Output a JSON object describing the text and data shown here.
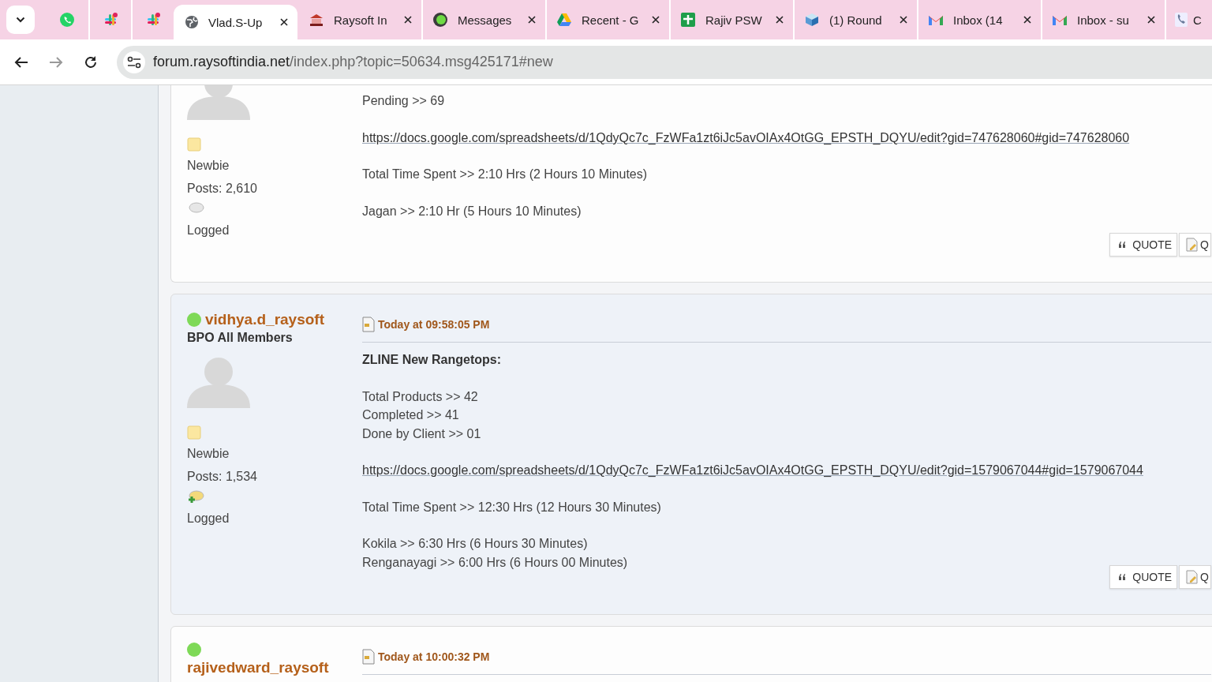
{
  "tabs": [
    {
      "kind": "whatsapp",
      "selected": false
    },
    {
      "kind": "slack",
      "selected": false
    },
    {
      "kind": "slack",
      "selected": false
    },
    {
      "kind": "globe",
      "selected": true,
      "title": "Vlad.S-Up"
    },
    {
      "kind": "raysoft",
      "selected": false,
      "title": "Raysoft In"
    },
    {
      "kind": "upwork",
      "selected": false,
      "title": "Messages"
    },
    {
      "kind": "drive",
      "selected": false,
      "title": "Recent - G"
    },
    {
      "kind": "sheets",
      "selected": false,
      "title": "Rajiv PSW"
    },
    {
      "kind": "cube",
      "selected": false,
      "title": "(1) Round"
    },
    {
      "kind": "gmail",
      "selected": false,
      "title": "Inbox (14"
    },
    {
      "kind": "gmail",
      "selected": false,
      "title": "Inbox - su"
    },
    {
      "kind": "phone",
      "selected": false,
      "title": "C"
    }
  ],
  "address_bar": {
    "host": "forum.raysoftindia.net",
    "path": "/index.php?topic=50634.msg425171#new"
  },
  "posts": [
    {
      "poster": {
        "rank": "Newbie",
        "posts": "Posts: 2,610",
        "contact_active": false,
        "logged": "Logged"
      },
      "body": [
        {
          "kind": "text",
          "lines": [
            "Pending >> 69"
          ]
        },
        {
          "kind": "link",
          "lines": [
            "https://docs.google.com/spreadsheets/d/1QdyQc7c_FzWFa1zt6iJc5avOIAx4OtGG_EPSTH_DQYU/edit?gid=747628060#gid=747628060"
          ]
        },
        {
          "kind": "text",
          "lines": [
            "Total Time Spent >> 2:10 Hrs (2 Hours 10 Minutes)"
          ]
        },
        {
          "kind": "text",
          "lines": [
            "Jagan >>  2:10 Hr (5 Hours 10 Minutes)"
          ]
        }
      ],
      "buttons": [
        "QUOTE",
        "Q"
      ],
      "shaded": false
    },
    {
      "poster": {
        "online": true,
        "name": "vidhya.d_raysoft",
        "group": "BPO All Members",
        "rank": "Newbie",
        "posts": "Posts: 1,534",
        "contact_active": true,
        "logged": "Logged"
      },
      "date": "Today at 09:58:05 PM",
      "body": [
        {
          "kind": "bold",
          "lines": [
            "ZLINE New Rangetops:"
          ]
        },
        {
          "kind": "text",
          "lines": [
            "Total Products >> 42",
            "Completed >> 41",
            "Done by Client >> 01"
          ]
        },
        {
          "kind": "link",
          "lines": [
            "https://docs.google.com/spreadsheets/d/1QdyQc7c_FzWFa1zt6iJc5avOIAx4OtGG_EPSTH_DQYU/edit?gid=1579067044#gid=1579067044"
          ]
        },
        {
          "kind": "text",
          "lines": [
            "Total Time Spent >> 12:30 Hrs (12 Hours 30 Minutes)"
          ]
        },
        {
          "kind": "text",
          "lines": [
            "Kokila >>  6:30 Hrs (6 Hours 30 Minutes)",
            "Renganayagi >> 6:00 Hrs (6 Hours 00 Minutes)"
          ]
        }
      ],
      "buttons": [
        "QUOTE",
        "Q"
      ],
      "shaded": true
    },
    {
      "poster": {
        "online": true,
        "name": "rajivedward_raysoft"
      },
      "date": "Today at 10:00:32 PM",
      "shaded": false
    }
  ]
}
